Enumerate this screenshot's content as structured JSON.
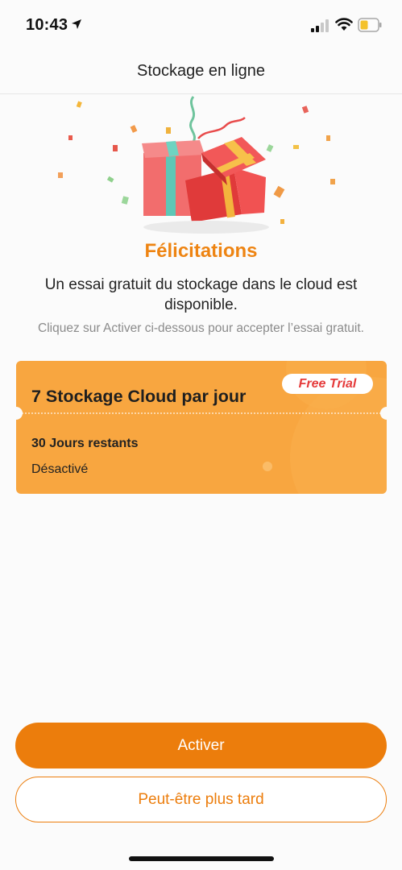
{
  "status_bar": {
    "time": "10:43"
  },
  "nav": {
    "title": "Stockage en ligne"
  },
  "hero": {
    "heading": "Félicitations",
    "subtitle": "Un essai gratuit du stockage dans le cloud est disponible.",
    "hint": "Cliquez sur Activer ci-dessous pour accepter l’essai gratuit."
  },
  "trial_card": {
    "title": "7 Stockage Cloud par jour",
    "badge": "Free Trial",
    "days_left": "30 Jours restants",
    "status": "Désactivé"
  },
  "actions": {
    "activate_label": "Activer",
    "later_label": "Peut-être plus tard"
  },
  "colors": {
    "accent": "#ec7d0c",
    "heading": "#ee8412",
    "card": "#f8a640",
    "badge_text": "#e53b3b"
  },
  "icons": [
    "location-arrow-icon",
    "cellular-signal-icon",
    "wifi-icon",
    "battery-icon",
    "gift-boxes-illustration"
  ]
}
